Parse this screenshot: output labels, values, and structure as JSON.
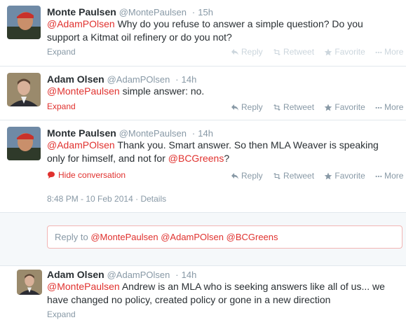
{
  "tweets": [
    {
      "fullname": "Monte Paulsen",
      "username": "@MontePaulsen",
      "time": "15h",
      "mention": "@AdamPOlsen",
      "text": " Why do you refuse to answer a simple question? Do you support a Kitmat oil refinery or do you not?",
      "expand": "Expand"
    },
    {
      "fullname": "Adam Olsen",
      "username": "@AdamPOlsen",
      "time": "14h",
      "mention": "@MontePaulsen",
      "text": " simple answer: no.",
      "expand": "Expand"
    },
    {
      "fullname": "Monte Paulsen",
      "username": "@MontePaulsen",
      "time": "14h",
      "mention": "@AdamPOlsen",
      "text": "  Thank you. Smart answer. So then MLA Weaver is speaking only for himself, and not for ",
      "mention2": "@BCGreens",
      "text_end": "?",
      "hide": "Hide conversation",
      "datetime": "8:48 PM - 10 Feb 2014",
      "details": "Details"
    },
    {
      "fullname": "Adam Olsen",
      "username": "@AdamPOlsen",
      "time": "14h",
      "mention": "@MontePaulsen",
      "text": " Andrew is an MLA who is seeking answers like all of us... we have changed no policy, created policy or gone in a new direction",
      "expand": "Expand"
    }
  ],
  "actions": {
    "reply": "Reply",
    "retweet": "Retweet",
    "favorite": "Favorite",
    "more": "More"
  },
  "reply_box": {
    "prefix": "Reply to ",
    "mentions": "@MontePaulsen @AdamPOlsen @BCGreens"
  },
  "colors": {
    "accent": "#e0312e",
    "muted": "#8899a6",
    "light": "#ccd6dd"
  },
  "icons": [
    "reply-arrow-icon",
    "retweet-icon",
    "star-icon",
    "ellipsis-icon",
    "speech-bubble-icon"
  ]
}
